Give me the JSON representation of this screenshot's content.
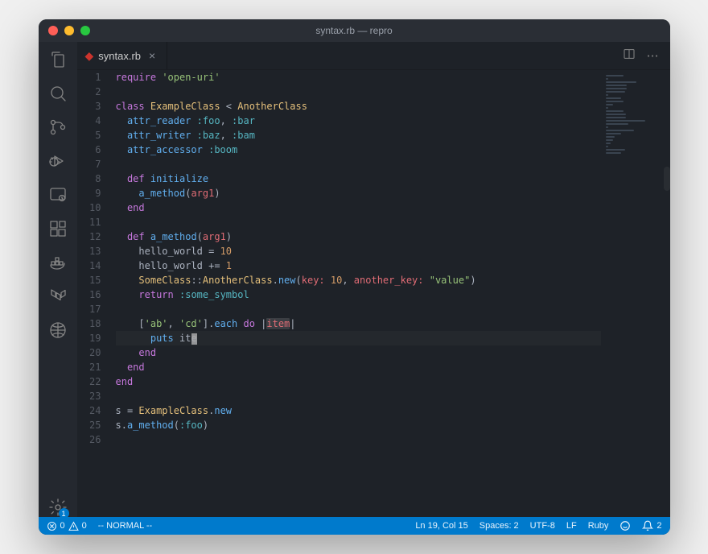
{
  "window": {
    "title": "syntax.rb — repro"
  },
  "tab": {
    "filename": "syntax.rb",
    "close_label": "×"
  },
  "statusbar": {
    "errors": "0",
    "warnings": "0",
    "mode": "-- NORMAL --",
    "position": "Ln 19, Col 15",
    "spaces": "Spaces: 2",
    "encoding": "UTF-8",
    "eol": "LF",
    "language": "Ruby",
    "notifications": "2"
  },
  "gear_badge": "1",
  "code": {
    "lines": [
      {
        "n": "1",
        "t": [
          [
            "kw",
            "require"
          ],
          [
            "pl",
            " "
          ],
          [
            "str",
            "'open-uri'"
          ]
        ]
      },
      {
        "n": "2",
        "t": []
      },
      {
        "n": "3",
        "t": [
          [
            "kw",
            "class"
          ],
          [
            "pl",
            " "
          ],
          [
            "id",
            "ExampleClass"
          ],
          [
            "pl",
            " < "
          ],
          [
            "id",
            "AnotherClass"
          ]
        ]
      },
      {
        "n": "4",
        "t": [
          [
            "pl",
            "  "
          ],
          [
            "fn",
            "attr_reader"
          ],
          [
            "pl",
            " "
          ],
          [
            "sym",
            ":foo"
          ],
          [
            "pl",
            ", "
          ],
          [
            "sym",
            ":bar"
          ]
        ]
      },
      {
        "n": "5",
        "t": [
          [
            "pl",
            "  "
          ],
          [
            "fn",
            "attr_writer"
          ],
          [
            "pl",
            " "
          ],
          [
            "sym",
            ":baz"
          ],
          [
            "pl",
            ", "
          ],
          [
            "sym",
            ":bam"
          ]
        ]
      },
      {
        "n": "6",
        "t": [
          [
            "pl",
            "  "
          ],
          [
            "fn",
            "attr_accessor"
          ],
          [
            "pl",
            " "
          ],
          [
            "sym",
            ":boom"
          ]
        ]
      },
      {
        "n": "7",
        "t": [
          [
            "pl",
            "  "
          ]
        ]
      },
      {
        "n": "8",
        "t": [
          [
            "pl",
            "  "
          ],
          [
            "kw",
            "def"
          ],
          [
            "pl",
            " "
          ],
          [
            "fn",
            "initialize"
          ]
        ]
      },
      {
        "n": "9",
        "t": [
          [
            "pl",
            "    "
          ],
          [
            "fn",
            "a_method"
          ],
          [
            "pl",
            "("
          ],
          [
            "param",
            "arg1"
          ],
          [
            "pl",
            ")"
          ]
        ]
      },
      {
        "n": "10",
        "t": [
          [
            "pl",
            "  "
          ],
          [
            "kw",
            "end"
          ]
        ]
      },
      {
        "n": "11",
        "t": []
      },
      {
        "n": "12",
        "t": [
          [
            "pl",
            "  "
          ],
          [
            "kw",
            "def"
          ],
          [
            "pl",
            " "
          ],
          [
            "fn",
            "a_method"
          ],
          [
            "pl",
            "("
          ],
          [
            "param",
            "arg1"
          ],
          [
            "pl",
            ")"
          ]
        ]
      },
      {
        "n": "13",
        "t": [
          [
            "pl",
            "    "
          ],
          [
            "pl",
            "hello_world = "
          ],
          [
            "num",
            "10"
          ]
        ]
      },
      {
        "n": "14",
        "t": [
          [
            "pl",
            "    "
          ],
          [
            "pl",
            "hello_world += "
          ],
          [
            "num",
            "1"
          ]
        ]
      },
      {
        "n": "15",
        "t": [
          [
            "pl",
            "    "
          ],
          [
            "id",
            "SomeClass"
          ],
          [
            "pl",
            "::"
          ],
          [
            "id",
            "AnotherClass"
          ],
          [
            "pl",
            "."
          ],
          [
            "fn",
            "new"
          ],
          [
            "pl",
            "("
          ],
          [
            "param",
            "key:"
          ],
          [
            "pl",
            " "
          ],
          [
            "num",
            "10"
          ],
          [
            "pl",
            ", "
          ],
          [
            "param",
            "another_key:"
          ],
          [
            "pl",
            " "
          ],
          [
            "str",
            "\"value\""
          ],
          [
            "pl",
            ")"
          ]
        ]
      },
      {
        "n": "16",
        "t": [
          [
            "pl",
            "    "
          ],
          [
            "kw",
            "return"
          ],
          [
            "pl",
            " "
          ],
          [
            "sym",
            ":some_symbol"
          ]
        ]
      },
      {
        "n": "17",
        "t": []
      },
      {
        "n": "18",
        "t": [
          [
            "pl",
            "    ["
          ],
          [
            "str",
            "'ab'"
          ],
          [
            "pl",
            ", "
          ],
          [
            "str",
            "'cd'"
          ],
          [
            "pl",
            "]."
          ],
          [
            "fn",
            "each"
          ],
          [
            "pl",
            " "
          ],
          [
            "kw",
            "do"
          ],
          [
            "pl",
            " |"
          ],
          [
            "param",
            "item",
            "sel"
          ],
          [
            "pl",
            "|"
          ]
        ]
      },
      {
        "n": "19",
        "t": [
          [
            "pl",
            "      "
          ],
          [
            "fn",
            "puts"
          ],
          [
            "pl",
            " "
          ],
          [
            "pl",
            "ite"
          ],
          [
            "pl",
            "m",
            "cursor"
          ]
        ],
        "current": true
      },
      {
        "n": "20",
        "t": [
          [
            "pl",
            "    "
          ],
          [
            "kw",
            "end"
          ]
        ]
      },
      {
        "n": "21",
        "t": [
          [
            "pl",
            "  "
          ],
          [
            "kw",
            "end"
          ]
        ]
      },
      {
        "n": "22",
        "t": [
          [
            "kw",
            "end"
          ]
        ]
      },
      {
        "n": "23",
        "t": []
      },
      {
        "n": "24",
        "t": [
          [
            "pl",
            "s = "
          ],
          [
            "id",
            "ExampleClass"
          ],
          [
            "pl",
            "."
          ],
          [
            "fn",
            "new"
          ]
        ]
      },
      {
        "n": "25",
        "t": [
          [
            "pl",
            "s."
          ],
          [
            "fn",
            "a_method"
          ],
          [
            "pl",
            "("
          ],
          [
            "sym",
            ":foo"
          ],
          [
            "pl",
            ")"
          ]
        ]
      },
      {
        "n": "26",
        "t": []
      }
    ]
  }
}
